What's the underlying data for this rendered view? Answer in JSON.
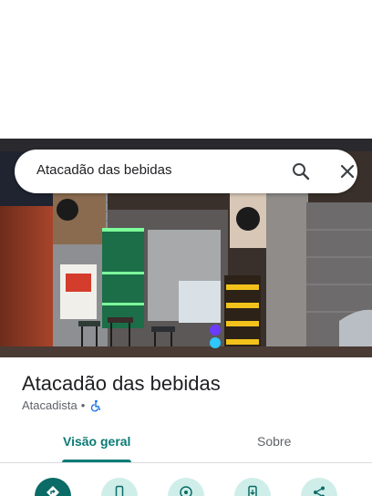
{
  "search": {
    "query": "Atacadão das bebidas"
  },
  "place": {
    "name": "Atacadão das bebidas",
    "category": "Atacadista",
    "separator": "•"
  },
  "tabs": [
    {
      "label": "Visão geral",
      "active": true
    },
    {
      "label": "Sobre",
      "active": false
    }
  ],
  "actions": [
    {
      "icon": "directions-icon"
    },
    {
      "icon": "phone-icon"
    },
    {
      "icon": "save-icon"
    },
    {
      "icon": "add-to-phone-icon"
    },
    {
      "icon": "share-icon"
    }
  ],
  "colors": {
    "accent": "#0b7a75",
    "action_bg": "#cfeee9",
    "primary_action": "#0b6b66"
  }
}
